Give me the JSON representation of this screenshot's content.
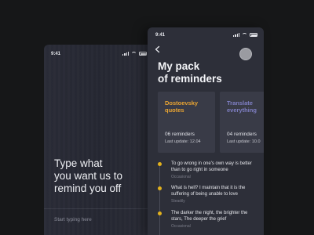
{
  "left_screen": {
    "status_time": "9:41",
    "prompt_heading": "Type what\nyou want us to\nremind you off",
    "input_placeholder": "Start typing here"
  },
  "right_screen": {
    "status_time": "9:41",
    "title": "My pack\nof reminders",
    "cards": [
      {
        "title": "Dostoevsky\nquotes",
        "title_color": "#e9a432",
        "count": "06 reminders",
        "last_update": "Last update: 12.04"
      },
      {
        "title": "Translate\neverything",
        "title_color": "#7f7fc4",
        "count": "04 reminders",
        "last_update": "Last update: 10.0"
      }
    ],
    "reminders": [
      {
        "text": "To go wrong in one's own way is better than to go right in someone",
        "tag": "Occasional"
      },
      {
        "text": "What is hell? I maintain that it is the suffering of being unable to love",
        "tag": "Steadily"
      },
      {
        "text": "The darker the night, the brighter the stars, The deeper the grief",
        "tag": "Occasional"
      }
    ]
  },
  "colors": {
    "background": "#161718",
    "phone_bg": "#2d2f39",
    "card_bg": "#393b47",
    "accent_dot": "#e3b21d"
  },
  "icons": [
    "back-arrow-icon",
    "signal-icon",
    "wifi-icon",
    "battery-icon",
    "avatar"
  ]
}
